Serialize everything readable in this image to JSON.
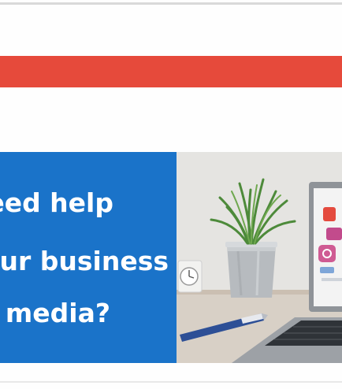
{
  "banner": {
    "line1": "eed help",
    "line2": "ur business",
    "line3": "media?",
    "panel_color": "#1a73c9",
    "text_color": "#ffffff",
    "photo_alt": "laptop-and-plant-photo"
  },
  "accent_bar": {
    "color": "#e64a3b"
  }
}
